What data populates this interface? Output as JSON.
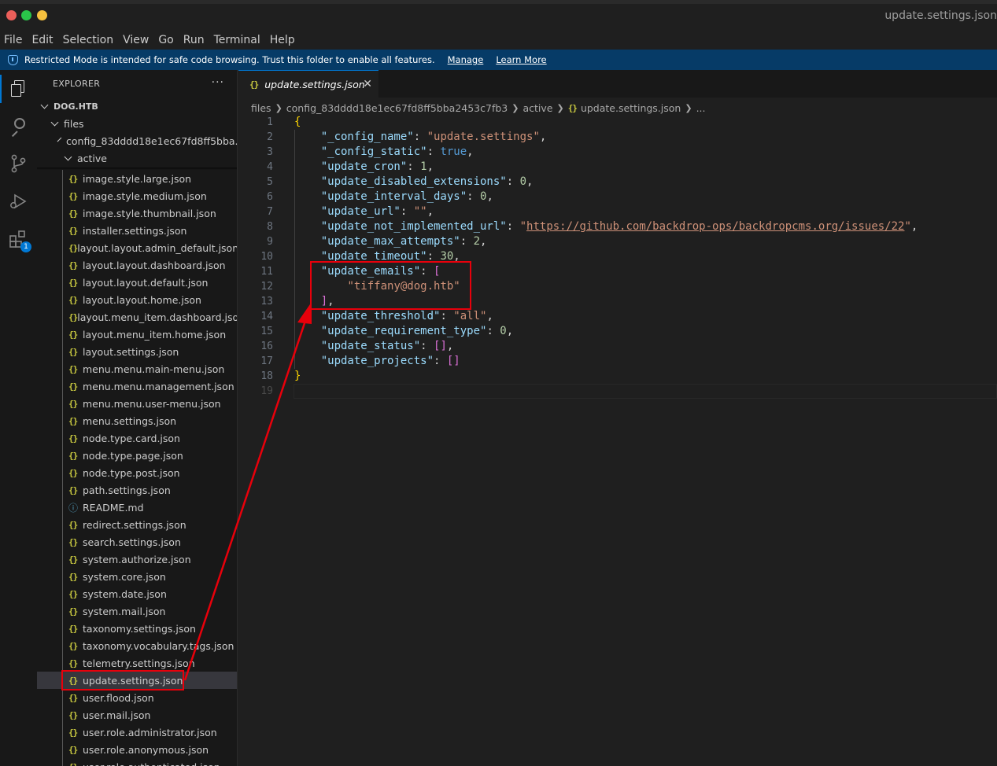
{
  "window": {
    "title": "update.settings.json"
  },
  "menu": [
    "File",
    "Edit",
    "Selection",
    "View",
    "Go",
    "Run",
    "Terminal",
    "Help"
  ],
  "banner": {
    "message": "Restricted Mode is intended for safe code browsing. Trust this folder to enable all features.",
    "manage": "Manage",
    "learn_more": "Learn More"
  },
  "activity": {
    "extensions_badge": "1"
  },
  "explorer": {
    "header": "EXPLORER",
    "more": "···",
    "project": "DOG.HTB",
    "folder_files": "files",
    "folder_config": "config_83dddd18e1ec67fd8ff5bba...",
    "folder_active": "active",
    "files": [
      "image.style.large.json",
      "image.style.medium.json",
      "image.style.thumbnail.json",
      "installer.settings.json",
      "layout.layout.admin_default.json",
      "layout.layout.dashboard.json",
      "layout.layout.default.json",
      "layout.layout.home.json",
      "layout.menu_item.dashboard.json",
      "layout.menu_item.home.json",
      "layout.settings.json",
      "menu.menu.main-menu.json",
      "menu.menu.management.json",
      "menu.menu.user-menu.json",
      "menu.settings.json",
      "node.type.card.json",
      "node.type.page.json",
      "node.type.post.json",
      "path.settings.json",
      "README.md",
      "redirect.settings.json",
      "search.settings.json",
      "system.authorize.json",
      "system.core.json",
      "system.date.json",
      "system.mail.json",
      "taxonomy.settings.json",
      "taxonomy.vocabulary.tags.json",
      "telemetry.settings.json",
      "update.settings.json",
      "user.flood.json",
      "user.mail.json",
      "user.role.administrator.json",
      "user.role.anonymous.json",
      "user.role.authenticated.json"
    ],
    "selected_file": "update.settings.json"
  },
  "editor": {
    "tab_label": "update.settings.json",
    "breadcrumb": [
      "files",
      "config_83dddd18e1ec67fd8ff5bba2453c7fb3",
      "active",
      "update.settings.json",
      "..."
    ],
    "line_numbers": [
      "1",
      "2",
      "3",
      "4",
      "5",
      "6",
      "7",
      "8",
      "9",
      "10",
      "11",
      "12",
      "13",
      "14",
      "15",
      "16",
      "17",
      "18",
      "19"
    ],
    "code": {
      "config_name_key": "\"_config_name\"",
      "config_name_val": "\"update.settings\"",
      "config_static_key": "\"_config_static\"",
      "config_static_val": "true",
      "cron_key": "\"update_cron\"",
      "cron_val": "1",
      "disabled_ext_key": "\"update_disabled_extensions\"",
      "disabled_ext_val": "0",
      "interval_key": "\"update_interval_days\"",
      "interval_val": "0",
      "url_key": "\"update_url\"",
      "url_val": "\"\"",
      "not_impl_key": "\"update_not_implemented_url\"",
      "not_impl_val": "https://github.com/backdrop-ops/backdropcms.org/issues/22",
      "max_attempts_key": "\"update_max_attempts\"",
      "max_attempts_val": "2",
      "timeout_key": "\"update_timeout\"",
      "timeout_val": "30",
      "emails_key": "\"update_emails\"",
      "emails_item": "\"tiffany@dog.htb\"",
      "threshold_key": "\"update_threshold\"",
      "threshold_val": "\"all\"",
      "req_type_key": "\"update_requirement_type\"",
      "req_type_val": "0",
      "status_key": "\"update_status\"",
      "projects_key": "\"update_projects\""
    }
  },
  "colors": {
    "annotation": "#e8000b",
    "accent": "#0078d4",
    "banner": "#063b67"
  }
}
